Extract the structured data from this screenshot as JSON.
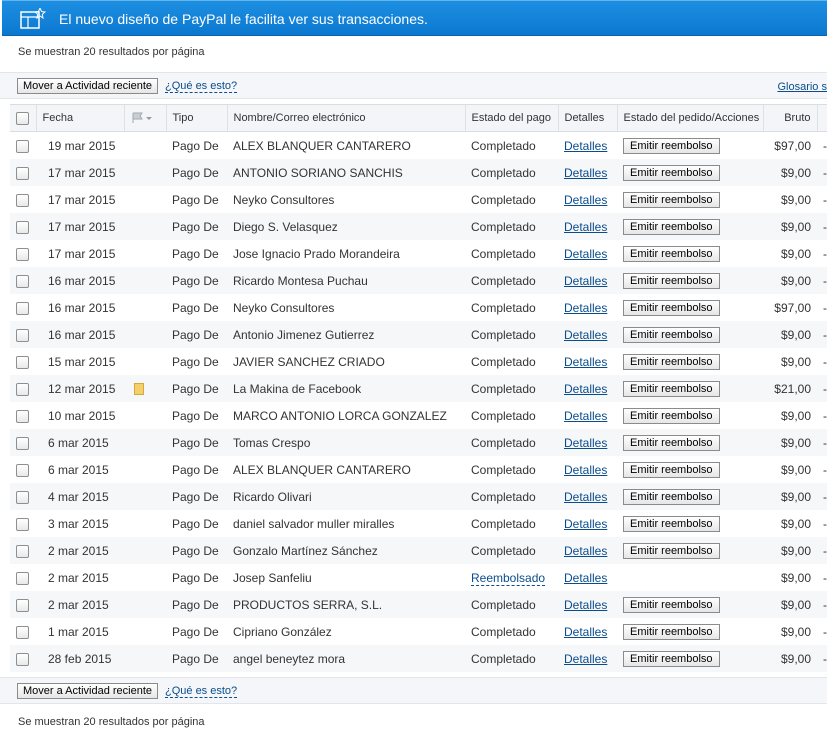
{
  "banner": {
    "text": "El nuevo diseño de PayPal le facilita ver sus transacciones.",
    "icon": "layout-star-icon"
  },
  "results_info_top": "Se muestran 20 resultados por página",
  "results_info_bottom": "Se muestran 20 resultados por página",
  "actions": {
    "move_label": "Mover a Actividad reciente",
    "what_label": "¿Qué es esto?",
    "glossary_label": "Glosario s"
  },
  "columns": {
    "date": "Fecha",
    "type": "Tipo",
    "name": "Nombre/Correo electrónico",
    "status": "Estado del pago",
    "details": "Detalles",
    "order": "Estado del pedido/Acciones",
    "gross": "Bruto"
  },
  "rows": [
    {
      "date": "19 mar 2015",
      "type": "Pago De",
      "name": "ALEX BLANQUER CANTARERO",
      "status": "Completado",
      "details": "Detalles",
      "action": "Emitir reembolso",
      "gross": "$97,00",
      "note": false
    },
    {
      "date": "17 mar 2015",
      "type": "Pago De",
      "name": "ANTONIO SORIANO SANCHIS",
      "status": "Completado",
      "details": "Detalles",
      "action": "Emitir reembolso",
      "gross": "$9,00",
      "note": false
    },
    {
      "date": "17 mar 2015",
      "type": "Pago De",
      "name": "Neyko Consultores",
      "status": "Completado",
      "details": "Detalles",
      "action": "Emitir reembolso",
      "gross": "$9,00",
      "note": false
    },
    {
      "date": "17 mar 2015",
      "type": "Pago De",
      "name": "Diego S. Velasquez",
      "status": "Completado",
      "details": "Detalles",
      "action": "Emitir reembolso",
      "gross": "$9,00",
      "note": false
    },
    {
      "date": "17 mar 2015",
      "type": "Pago De",
      "name": "Jose Ignacio Prado Morandeira",
      "status": "Completado",
      "details": "Detalles",
      "action": "Emitir reembolso",
      "gross": "$9,00",
      "note": false
    },
    {
      "date": "16 mar 2015",
      "type": "Pago De",
      "name": "Ricardo Montesa Puchau",
      "status": "Completado",
      "details": "Detalles",
      "action": "Emitir reembolso",
      "gross": "$9,00",
      "note": false
    },
    {
      "date": "16 mar 2015",
      "type": "Pago De",
      "name": "Neyko Consultores",
      "status": "Completado",
      "details": "Detalles",
      "action": "Emitir reembolso",
      "gross": "$97,00",
      "note": false
    },
    {
      "date": "16 mar 2015",
      "type": "Pago De",
      "name": "Antonio Jimenez Gutierrez",
      "status": "Completado",
      "details": "Detalles",
      "action": "Emitir reembolso",
      "gross": "$9,00",
      "note": false
    },
    {
      "date": "15 mar 2015",
      "type": "Pago De",
      "name": "JAVIER SANCHEZ CRIADO",
      "status": "Completado",
      "details": "Detalles",
      "action": "Emitir reembolso",
      "gross": "$9,00",
      "note": false
    },
    {
      "date": "12 mar 2015",
      "type": "Pago De",
      "name": "La Makina de Facebook",
      "status": "Completado",
      "details": "Detalles",
      "action": "Emitir reembolso",
      "gross": "$21,00",
      "note": true
    },
    {
      "date": "10 mar 2015",
      "type": "Pago De",
      "name": "MARCO ANTONIO LORCA GONZALEZ",
      "status": "Completado",
      "details": "Detalles",
      "action": "Emitir reembolso",
      "gross": "$9,00",
      "note": false
    },
    {
      "date": "6 mar 2015",
      "type": "Pago De",
      "name": "Tomas Crespo",
      "status": "Completado",
      "details": "Detalles",
      "action": "Emitir reembolso",
      "gross": "$9,00",
      "note": false
    },
    {
      "date": "6 mar 2015",
      "type": "Pago De",
      "name": "ALEX BLANQUER CANTARERO",
      "status": "Completado",
      "details": "Detalles",
      "action": "Emitir reembolso",
      "gross": "$9,00",
      "note": false
    },
    {
      "date": "4 mar 2015",
      "type": "Pago De",
      "name": "Ricardo Olivari",
      "status": "Completado",
      "details": "Detalles",
      "action": "Emitir reembolso",
      "gross": "$9,00",
      "note": false
    },
    {
      "date": "3 mar 2015",
      "type": "Pago De",
      "name": "daniel salvador muller miralles",
      "status": "Completado",
      "details": "Detalles",
      "action": "Emitir reembolso",
      "gross": "$9,00",
      "note": false
    },
    {
      "date": "2 mar 2015",
      "type": "Pago De",
      "name": "Gonzalo Martínez Sánchez",
      "status": "Completado",
      "details": "Detalles",
      "action": "Emitir reembolso",
      "gross": "$9,00",
      "note": false
    },
    {
      "date": "2 mar 2015",
      "type": "Pago De",
      "name": "Josep Sanfeliu",
      "status": "Reembolsado",
      "details": "Detalles",
      "action": "",
      "gross": "$9,00",
      "note": false
    },
    {
      "date": "2 mar 2015",
      "type": "Pago De",
      "name": "PRODUCTOS SERRA, S.L.",
      "status": "Completado",
      "details": "Detalles",
      "action": "Emitir reembolso",
      "gross": "$9,00",
      "note": false
    },
    {
      "date": "1 mar 2015",
      "type": "Pago De",
      "name": "Cipriano González",
      "status": "Completado",
      "details": "Detalles",
      "action": "Emitir reembolso",
      "gross": "$9,00",
      "note": false
    },
    {
      "date": "28 feb 2015",
      "type": "Pago De",
      "name": "angel beneytez mora",
      "status": "Completado",
      "details": "Detalles",
      "action": "Emitir reembolso",
      "gross": "$9,00",
      "note": false
    }
  ],
  "colors": {
    "banner": "#0b78d0",
    "link": "#0a4d8c"
  }
}
